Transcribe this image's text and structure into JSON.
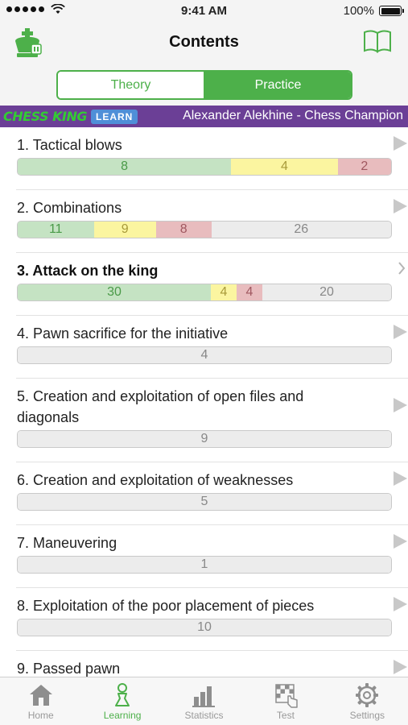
{
  "status_bar": {
    "time": "9:41 AM",
    "battery": "100%"
  },
  "nav": {
    "title": "Contents",
    "left_icon": "chess-king-logo-icon",
    "right_icon": "book-icon"
  },
  "segment": {
    "theory": "Theory",
    "practice": "Practice",
    "selected": "Practice"
  },
  "banner": {
    "brand": "CHESS KING",
    "brand_badge": "LEARN",
    "course_title": "Alexander Alekhine - Chess Champion"
  },
  "chapters": [
    {
      "title": "1. Tactical blows",
      "active": false,
      "segments": [
        {
          "value": "8",
          "color": "green"
        },
        {
          "value": "4",
          "color": "yellow"
        },
        {
          "value": "2",
          "color": "red"
        }
      ]
    },
    {
      "title": "2. Combinations",
      "active": false,
      "segments": [
        {
          "value": "11",
          "color": "green"
        },
        {
          "value": "9",
          "color": "yellow"
        },
        {
          "value": "8",
          "color": "red"
        },
        {
          "value": "26",
          "color": "grey"
        }
      ]
    },
    {
      "title": "3. Attack on the king",
      "active": true,
      "segments": [
        {
          "value": "30",
          "color": "green"
        },
        {
          "value": "4",
          "color": "yellow"
        },
        {
          "value": "4",
          "color": "red"
        },
        {
          "value": "20",
          "color": "grey"
        }
      ]
    },
    {
      "title": "4. Pawn sacrifice for the initiative",
      "active": false,
      "segments": [
        {
          "value": "4",
          "color": "grey"
        }
      ]
    },
    {
      "title": "5. Creation and exploitation of open files and diagonals",
      "active": false,
      "segments": [
        {
          "value": "9",
          "color": "grey"
        }
      ]
    },
    {
      "title": "6. Creation and exploitation of weaknesses",
      "active": false,
      "segments": [
        {
          "value": "5",
          "color": "grey"
        }
      ]
    },
    {
      "title": "7. Maneuvering",
      "active": false,
      "segments": [
        {
          "value": "1",
          "color": "grey"
        }
      ]
    },
    {
      "title": "8. Exploitation of the poor placement of pieces",
      "active": false,
      "segments": [
        {
          "value": "10",
          "color": "grey"
        }
      ]
    },
    {
      "title": "9. Passed pawn",
      "active": false,
      "segments": []
    }
  ],
  "tabbar": {
    "home": "Home",
    "learning": "Learning",
    "statistics": "Statistics",
    "test": "Test",
    "settings": "Settings",
    "selected": "Learning"
  },
  "colors": {
    "accent": "#4db04a",
    "banner": "#6b3f96",
    "green": "#c5e3c3",
    "yellow": "#fbf5a0",
    "red": "#e8bcbe",
    "grey": "#ececec"
  }
}
